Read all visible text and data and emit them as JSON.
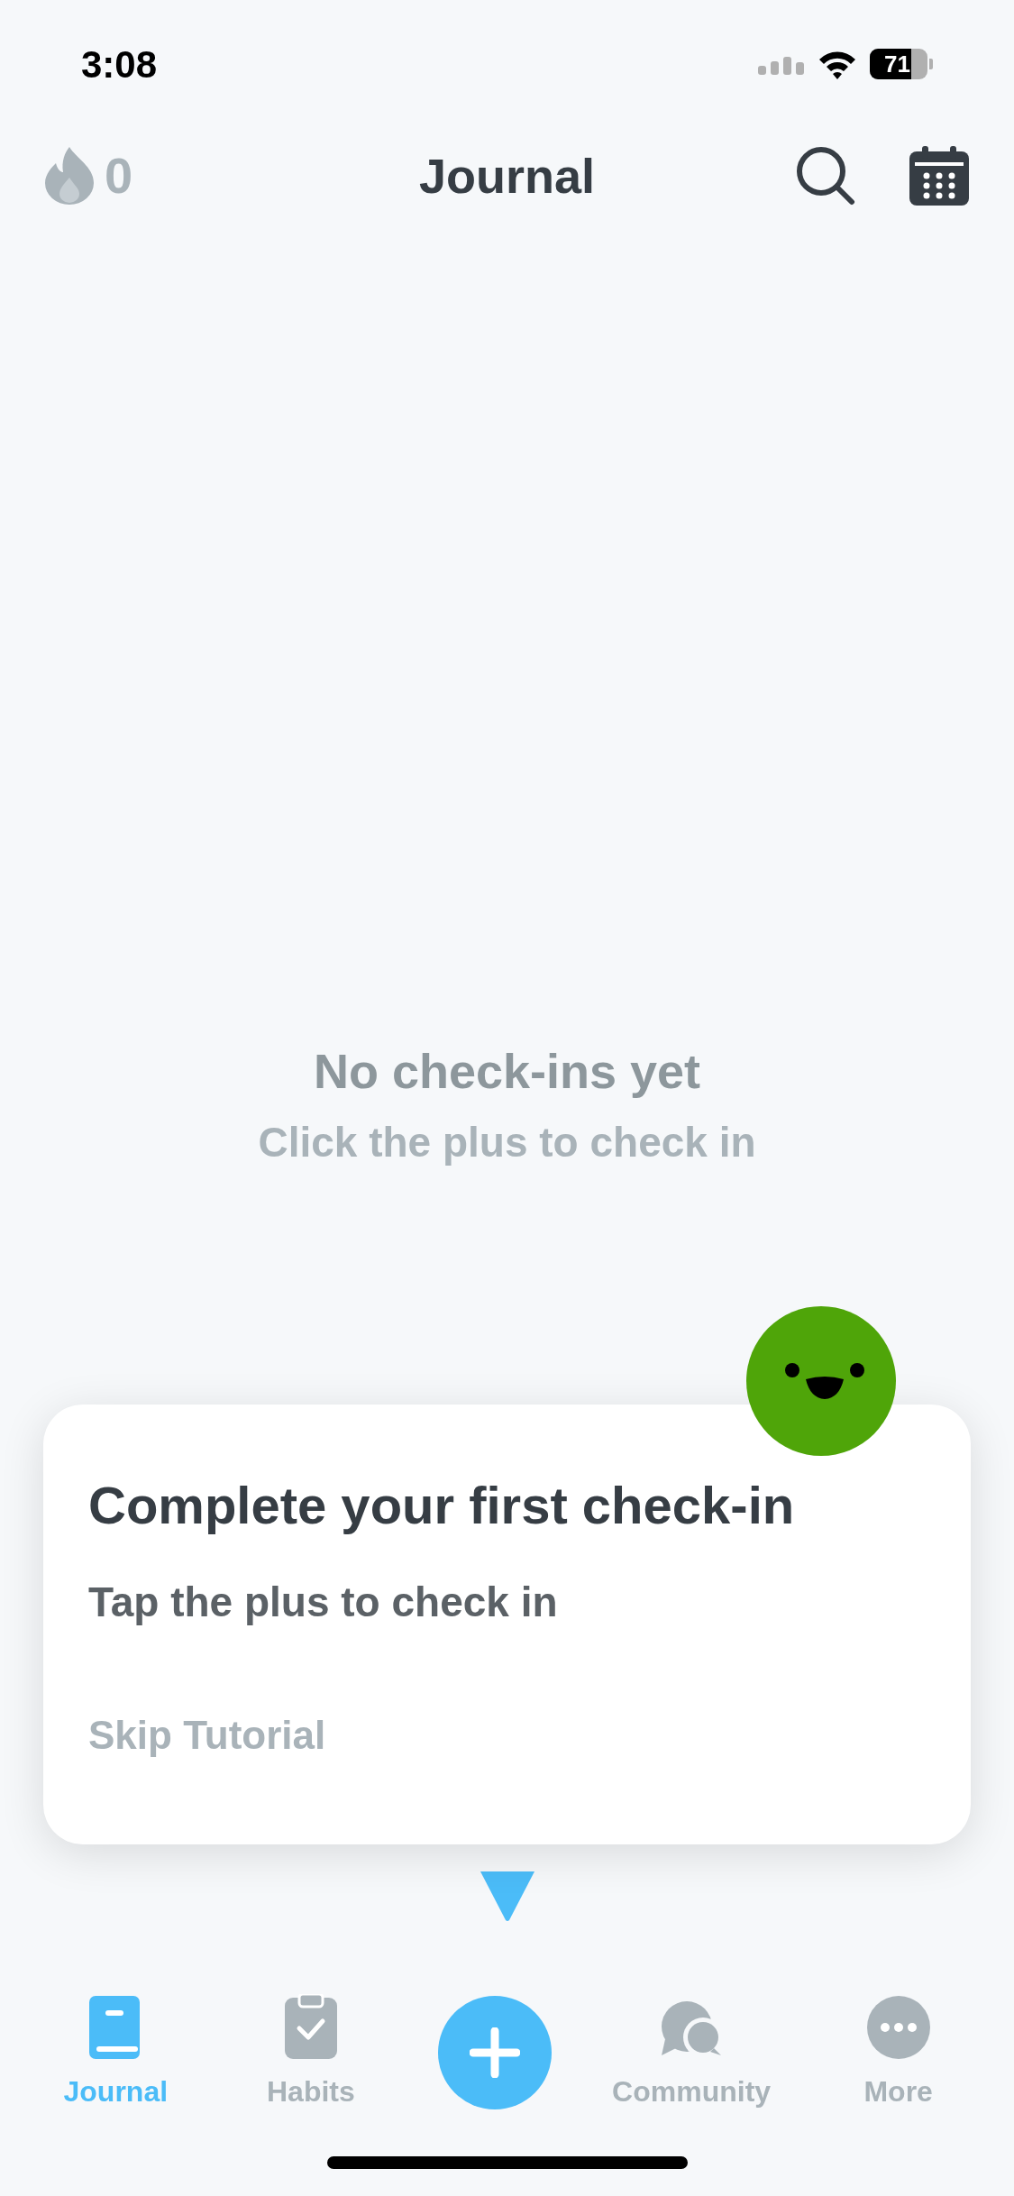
{
  "status_bar": {
    "time": "3:08",
    "battery": "71"
  },
  "header": {
    "streak": "0",
    "title": "Journal"
  },
  "empty_state": {
    "title": "No check-ins yet",
    "subtitle": "Click the plus to check in"
  },
  "tutorial": {
    "title": "Complete your first check-in",
    "body": "Tap the plus to check in",
    "skip": "Skip Tutorial"
  },
  "tab_bar": [
    {
      "kind": "tab",
      "label": "Journal",
      "selected": true
    },
    {
      "kind": "tab",
      "label": "Habits",
      "selected": false
    },
    {
      "kind": "action"
    },
    {
      "kind": "tab",
      "label": "Community",
      "selected": false
    },
    {
      "kind": "tab",
      "label": "More",
      "selected": false
    }
  ]
}
